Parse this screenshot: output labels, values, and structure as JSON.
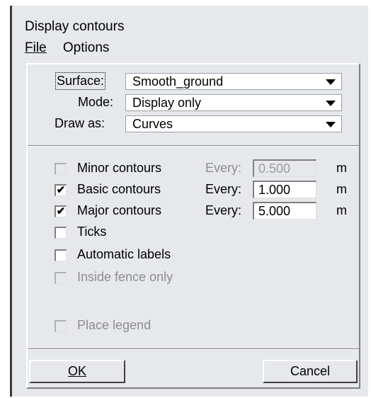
{
  "window": {
    "title": "Display contours"
  },
  "menu": {
    "file": "File",
    "options": "Options"
  },
  "settings": {
    "surface": {
      "label": "Surface:",
      "value": "Smooth_ground"
    },
    "mode": {
      "label": "Mode:",
      "value": "Display only"
    },
    "draw_as": {
      "label": "Draw as:",
      "value": "Curves"
    }
  },
  "contours": {
    "minor": {
      "label": "Minor contours",
      "checked": false,
      "enabled": false,
      "every_label": "Every:",
      "value": "0.500",
      "unit": "m"
    },
    "basic": {
      "label": "Basic contours",
      "checked": true,
      "enabled": true,
      "every_label": "Every:",
      "value": "1.000",
      "unit": "m"
    },
    "major": {
      "label": "Major contours",
      "checked": true,
      "enabled": true,
      "every_label": "Every:",
      "value": "5.000",
      "unit": "m"
    }
  },
  "options": {
    "ticks": {
      "label": "Ticks",
      "checked": false
    },
    "automatic_labels": {
      "label": "Automatic labels",
      "checked": false
    },
    "inside_fence_only": {
      "label": "Inside fence only",
      "checked": false,
      "enabled": false
    },
    "place_legend": {
      "label": "Place legend",
      "checked": false,
      "enabled": false
    }
  },
  "buttons": {
    "ok": "OK",
    "cancel": "Cancel"
  },
  "check_glyph": "✔"
}
